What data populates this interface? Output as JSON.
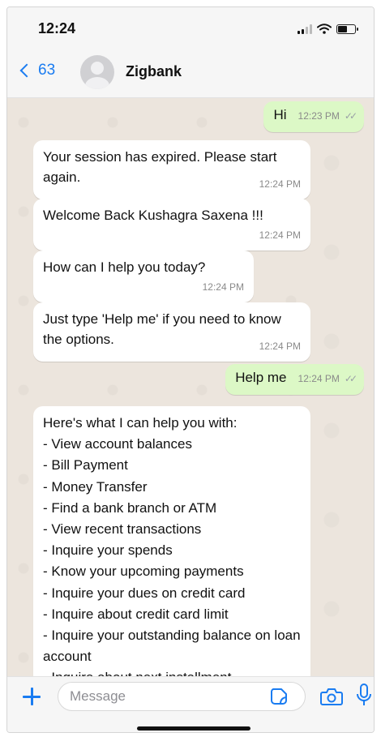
{
  "status_bar": {
    "time": "12:24"
  },
  "header": {
    "back_count": "63",
    "contact_name": "Zigbank"
  },
  "messages": [
    {
      "dir": "out",
      "text": "Hi",
      "time": "12:23 PM"
    },
    {
      "dir": "in",
      "text": "Your session has expired.  Please start again.",
      "time": "12:24 PM"
    },
    {
      "dir": "in",
      "text": "Welcome Back Kushagra Saxena !!!",
      "time": "12:24 PM"
    },
    {
      "dir": "in",
      "text": "How can I help you today?",
      "time": "12:24 PM"
    },
    {
      "dir": "in",
      "text": "Just type 'Help me' if you need to know the options.",
      "time": "12:24 PM"
    },
    {
      "dir": "out",
      "text": "Help me",
      "time": "12:24 PM"
    },
    {
      "dir": "in",
      "text": "Here's what I can help you with:\n- View account balances\n- Bill Payment\n- Money Transfer\n- Find a bank branch or ATM\n- View recent transactions\n- Inquire your spends\n- Know your upcoming payments\n- Inquire your dues on credit card\n- Inquire about credit card limit\n- Inquire your outstanding balance on loan account\n- Inquire about next installment"
    }
  ],
  "input": {
    "placeholder": "Message"
  },
  "colors": {
    "accent": "#1a7cf1",
    "outgoing_bubble": "#dcf8c6",
    "incoming_bubble": "#ffffff",
    "chat_background": "#ece5dd"
  },
  "icons": [
    "chevron-left-icon",
    "avatar-icon",
    "plus-icon",
    "sticker-icon",
    "camera-icon",
    "mic-icon",
    "double-check-icon",
    "signal-icon",
    "wifi-icon",
    "battery-icon"
  ]
}
